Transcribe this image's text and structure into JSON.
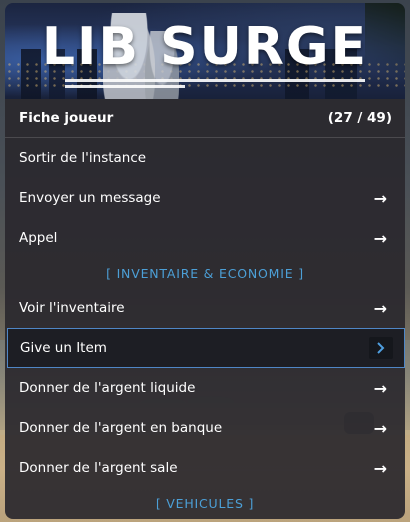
{
  "banner": {
    "logo_text": "LIB SURGE"
  },
  "header": {
    "title": "Fiche joueur",
    "counter": "(27 / 49)"
  },
  "items": [
    {
      "label": "Sortir de l'instance",
      "icon": ""
    },
    {
      "label": "Envoyer un message",
      "icon": "→"
    },
    {
      "label": "Appel",
      "icon": "→"
    }
  ],
  "sections": {
    "inventory": "[ INVENTAIRE & ECONOMIE ]",
    "vehicles": "[ VEHICULES ]"
  },
  "inventory_items": [
    {
      "label": "Voir l'inventaire",
      "icon": "→"
    },
    {
      "label": "Give un Item",
      "icon": "chevron-right-icon",
      "selected": true
    },
    {
      "label": "Donner de l'argent liquide",
      "icon": "→"
    },
    {
      "label": "Donner de l'argent en banque",
      "icon": "→"
    },
    {
      "label": "Donner de l'argent sale",
      "icon": "→"
    }
  ],
  "colors": {
    "accent": "#4c9fd6",
    "selected_border": "#4f86c6",
    "panel_bg": "#2a282e"
  }
}
